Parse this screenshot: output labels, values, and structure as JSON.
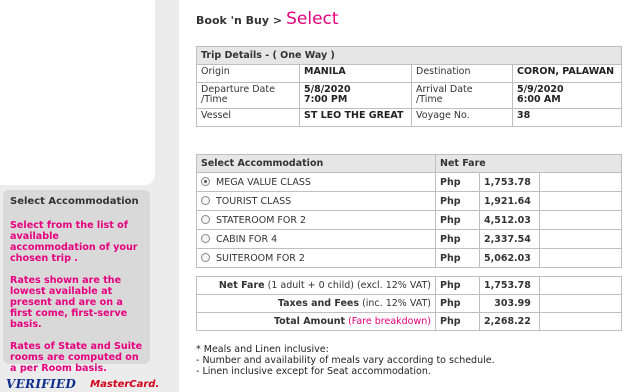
{
  "breadcrumb": {
    "link": "Book 'n Buy >",
    "current": "Select"
  },
  "trip": {
    "header": "Trip Details - ( One Way )",
    "origin_label": "Origin",
    "origin": "MANILA",
    "destination_label": "Destination",
    "destination": "CORON, PALAWAN",
    "departure_label_1": "Departure Date",
    "departure_label_2": "/Time",
    "departure_date": "5/8/2020",
    "departure_time": "7:00 PM",
    "arrival_label_1": "Arrival Date",
    "arrival_label_2": "/Time",
    "arrival_date": "5/9/2020",
    "arrival_time": "6:00 AM",
    "vessel_label": "Vessel",
    "vessel": "ST LEO THE GREAT",
    "voyage_label": "Voyage No.",
    "voyage": "38"
  },
  "accommodation": {
    "header": "Select Accommodation",
    "fare_header": "Net Fare",
    "items": [
      {
        "name": "MEGA VALUE CLASS",
        "currency": "Php",
        "amount": "1,753.78",
        "selected": true
      },
      {
        "name": "TOURIST CLASS",
        "currency": "Php",
        "amount": "1,921.64",
        "selected": false
      },
      {
        "name": "STATEROOM FOR 2",
        "currency": "Php",
        "amount": "4,512.03",
        "selected": false
      },
      {
        "name": "CABIN FOR 4",
        "currency": "Php",
        "amount": "2,337.54",
        "selected": false
      },
      {
        "name": "SUITEROOM FOR 2",
        "currency": "Php",
        "amount": "5,062.03",
        "selected": false
      }
    ]
  },
  "totals": {
    "net_fare_label": "Net Fare",
    "net_fare_detail": "(1 adult + 0 child) (excl. 12% VAT)",
    "net_fare_currency": "Php",
    "net_fare_amount": "1,753.78",
    "taxes_label": "Taxes and Fees",
    "taxes_detail": "(inc. 12% VAT)",
    "taxes_currency": "Php",
    "taxes_amount": "303.99",
    "total_label": "Total Amount",
    "total_link": "(Fare breakdown)",
    "total_currency": "Php",
    "total_amount": "2,268.22"
  },
  "notes": [
    "* Meals and Linen inclusive:",
    "- Number and availability of meals vary according to schedule.",
    "- Linen inclusive except for Seat accommodation."
  ],
  "sidebar": {
    "title": "Select Accommodation",
    "para1": "Select from the list of available accommodation of your chosen trip .",
    "para2": "Rates shown are the lowest available at present and are on a first come, first-serve basis.",
    "para3": "Rates of State and Suite rooms are computed on a per Room basis."
  },
  "logos": {
    "verified": "VERIFIED",
    "mastercard": "MasterCard."
  },
  "colors": {
    "accent": "#e6007e",
    "header_bg": "#e6e6e6",
    "sidebar_bg": "#d9d9d9"
  }
}
